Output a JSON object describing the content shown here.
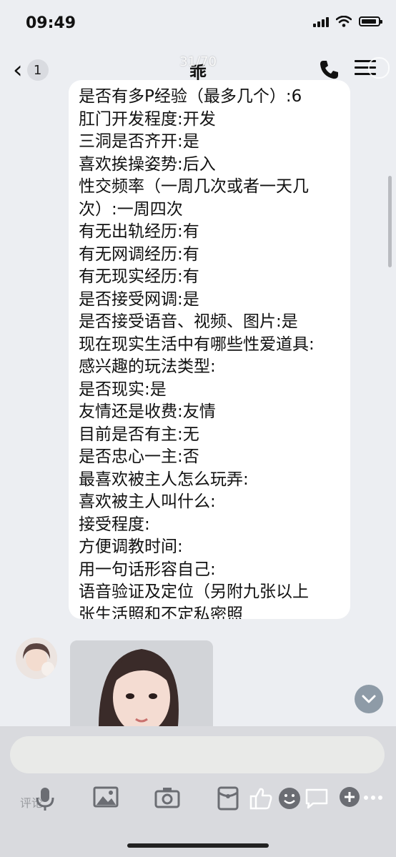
{
  "status_bar": {
    "time": "09:49"
  },
  "nav": {
    "back_icon": "‹",
    "unread_count": "1",
    "title": "乖",
    "image_counter": "31/70"
  },
  "message": {
    "lines": [
      "是否有多P经验（最多几个）:6",
      "肛门开发程度:开发",
      "三洞是否齐开:是",
      "喜欢挨操姿势:后入",
      "性交频率（一周几次或者一天几",
      "次）:一周四次",
      "有无出轨经历:有",
      "有无网调经历:有",
      "有无现实经历:有",
      "是否接受网调:是",
      "是否接受语音、视频、图片:是",
      "现在现实生活中有哪些性爱道具:",
      "感兴趣的玩法类型:",
      "是否现实:是",
      "友情还是收费:友情",
      "目前是否有主:无",
      "是否忠心一主:否",
      "最喜欢被主人怎么玩弄:",
      "喜欢被主人叫什么:",
      "接受程度:",
      "方便调教时间:",
      "用一句话形容自己:",
      "语音验证及定位（另附九张以上",
      "张生活照和不定私密照"
    ]
  },
  "bottom": {
    "comment_label": "评论"
  },
  "icons": [
    "back-chevron-icon",
    "phone-icon",
    "menu-icon",
    "chevron-down-icon",
    "microphone-icon",
    "image-icon",
    "camera-icon",
    "red-packet-icon",
    "thumbs-up-icon",
    "emoji-icon",
    "comment-icon",
    "plus-icon",
    "more-icon"
  ],
  "colors": {
    "background": "#eceef2",
    "bubble": "#ffffff",
    "bottom_bar": "#d9dade"
  }
}
